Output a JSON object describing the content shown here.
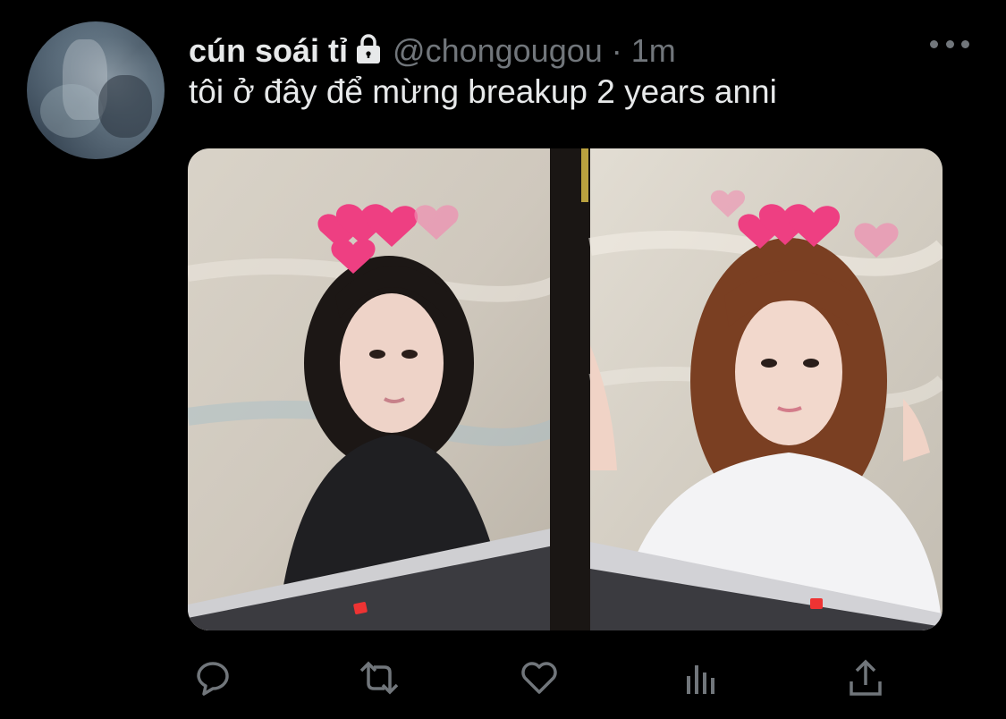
{
  "tweet": {
    "display_name": "cún soái tỉ",
    "protected_icon": "lock-icon",
    "handle": "@chongougou",
    "separator": "·",
    "time": "1m",
    "text": "tôi ở đây để mừng breakup 2 years anni",
    "more_icon": "more-horizontal-icon",
    "media": {
      "type": "photo",
      "panels": 2
    }
  },
  "actions": [
    {
      "name": "reply",
      "icon": "reply-bubble-icon"
    },
    {
      "name": "retweet",
      "icon": "retweet-icon"
    },
    {
      "name": "like",
      "icon": "heart-icon"
    },
    {
      "name": "analytics",
      "icon": "bar-chart-icon"
    },
    {
      "name": "share",
      "icon": "share-upload-icon"
    }
  ],
  "colors": {
    "background": "#000000",
    "primary_text": "#e7e9ea",
    "secondary_text": "#71767b"
  }
}
